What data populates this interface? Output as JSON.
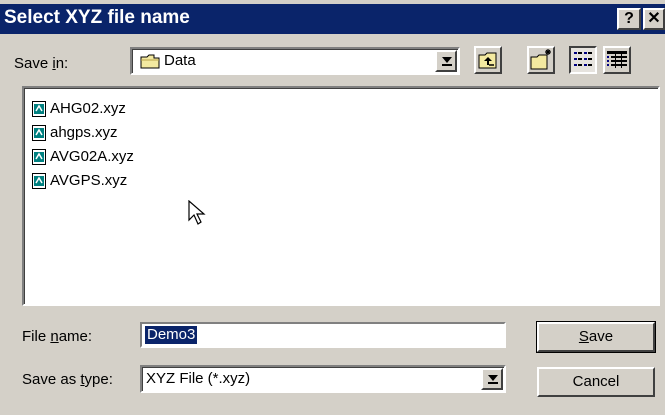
{
  "window": {
    "title": "Select XYZ file name",
    "help_label": "?",
    "close_label": "✕"
  },
  "save_in": {
    "label_pre": "Save ",
    "label_accel": "i",
    "label_post": "n:",
    "value": "Data",
    "icon": "folder-icon"
  },
  "toolbar": {
    "up_folder_icon": "up-one-level-icon",
    "new_folder_icon": "new-folder-icon",
    "list_view_icon": "list-view-icon",
    "details_view_icon": "details-view-icon"
  },
  "files": [
    {
      "name": "AHG02.xyz",
      "icon": "xyz-file-icon"
    },
    {
      "name": "ahgps.xyz",
      "icon": "xyz-file-icon"
    },
    {
      "name": "AVG02A.xyz",
      "icon": "xyz-file-icon"
    },
    {
      "name": "AVGPS.xyz",
      "icon": "xyz-file-icon"
    }
  ],
  "file_name": {
    "label_pre": "File ",
    "label_accel": "n",
    "label_post": "ame:",
    "value": "Demo3"
  },
  "save_as_type": {
    "label_pre": "Save as ",
    "label_accel": "t",
    "label_post": "ype:",
    "value": "XYZ File (*.xyz)"
  },
  "buttons": {
    "save_accel": "S",
    "save_rest": "ave",
    "cancel": "Cancel"
  },
  "colors": {
    "titlebar": "#0a246a",
    "face": "#d4d0c8",
    "selection": "#0a246a"
  }
}
